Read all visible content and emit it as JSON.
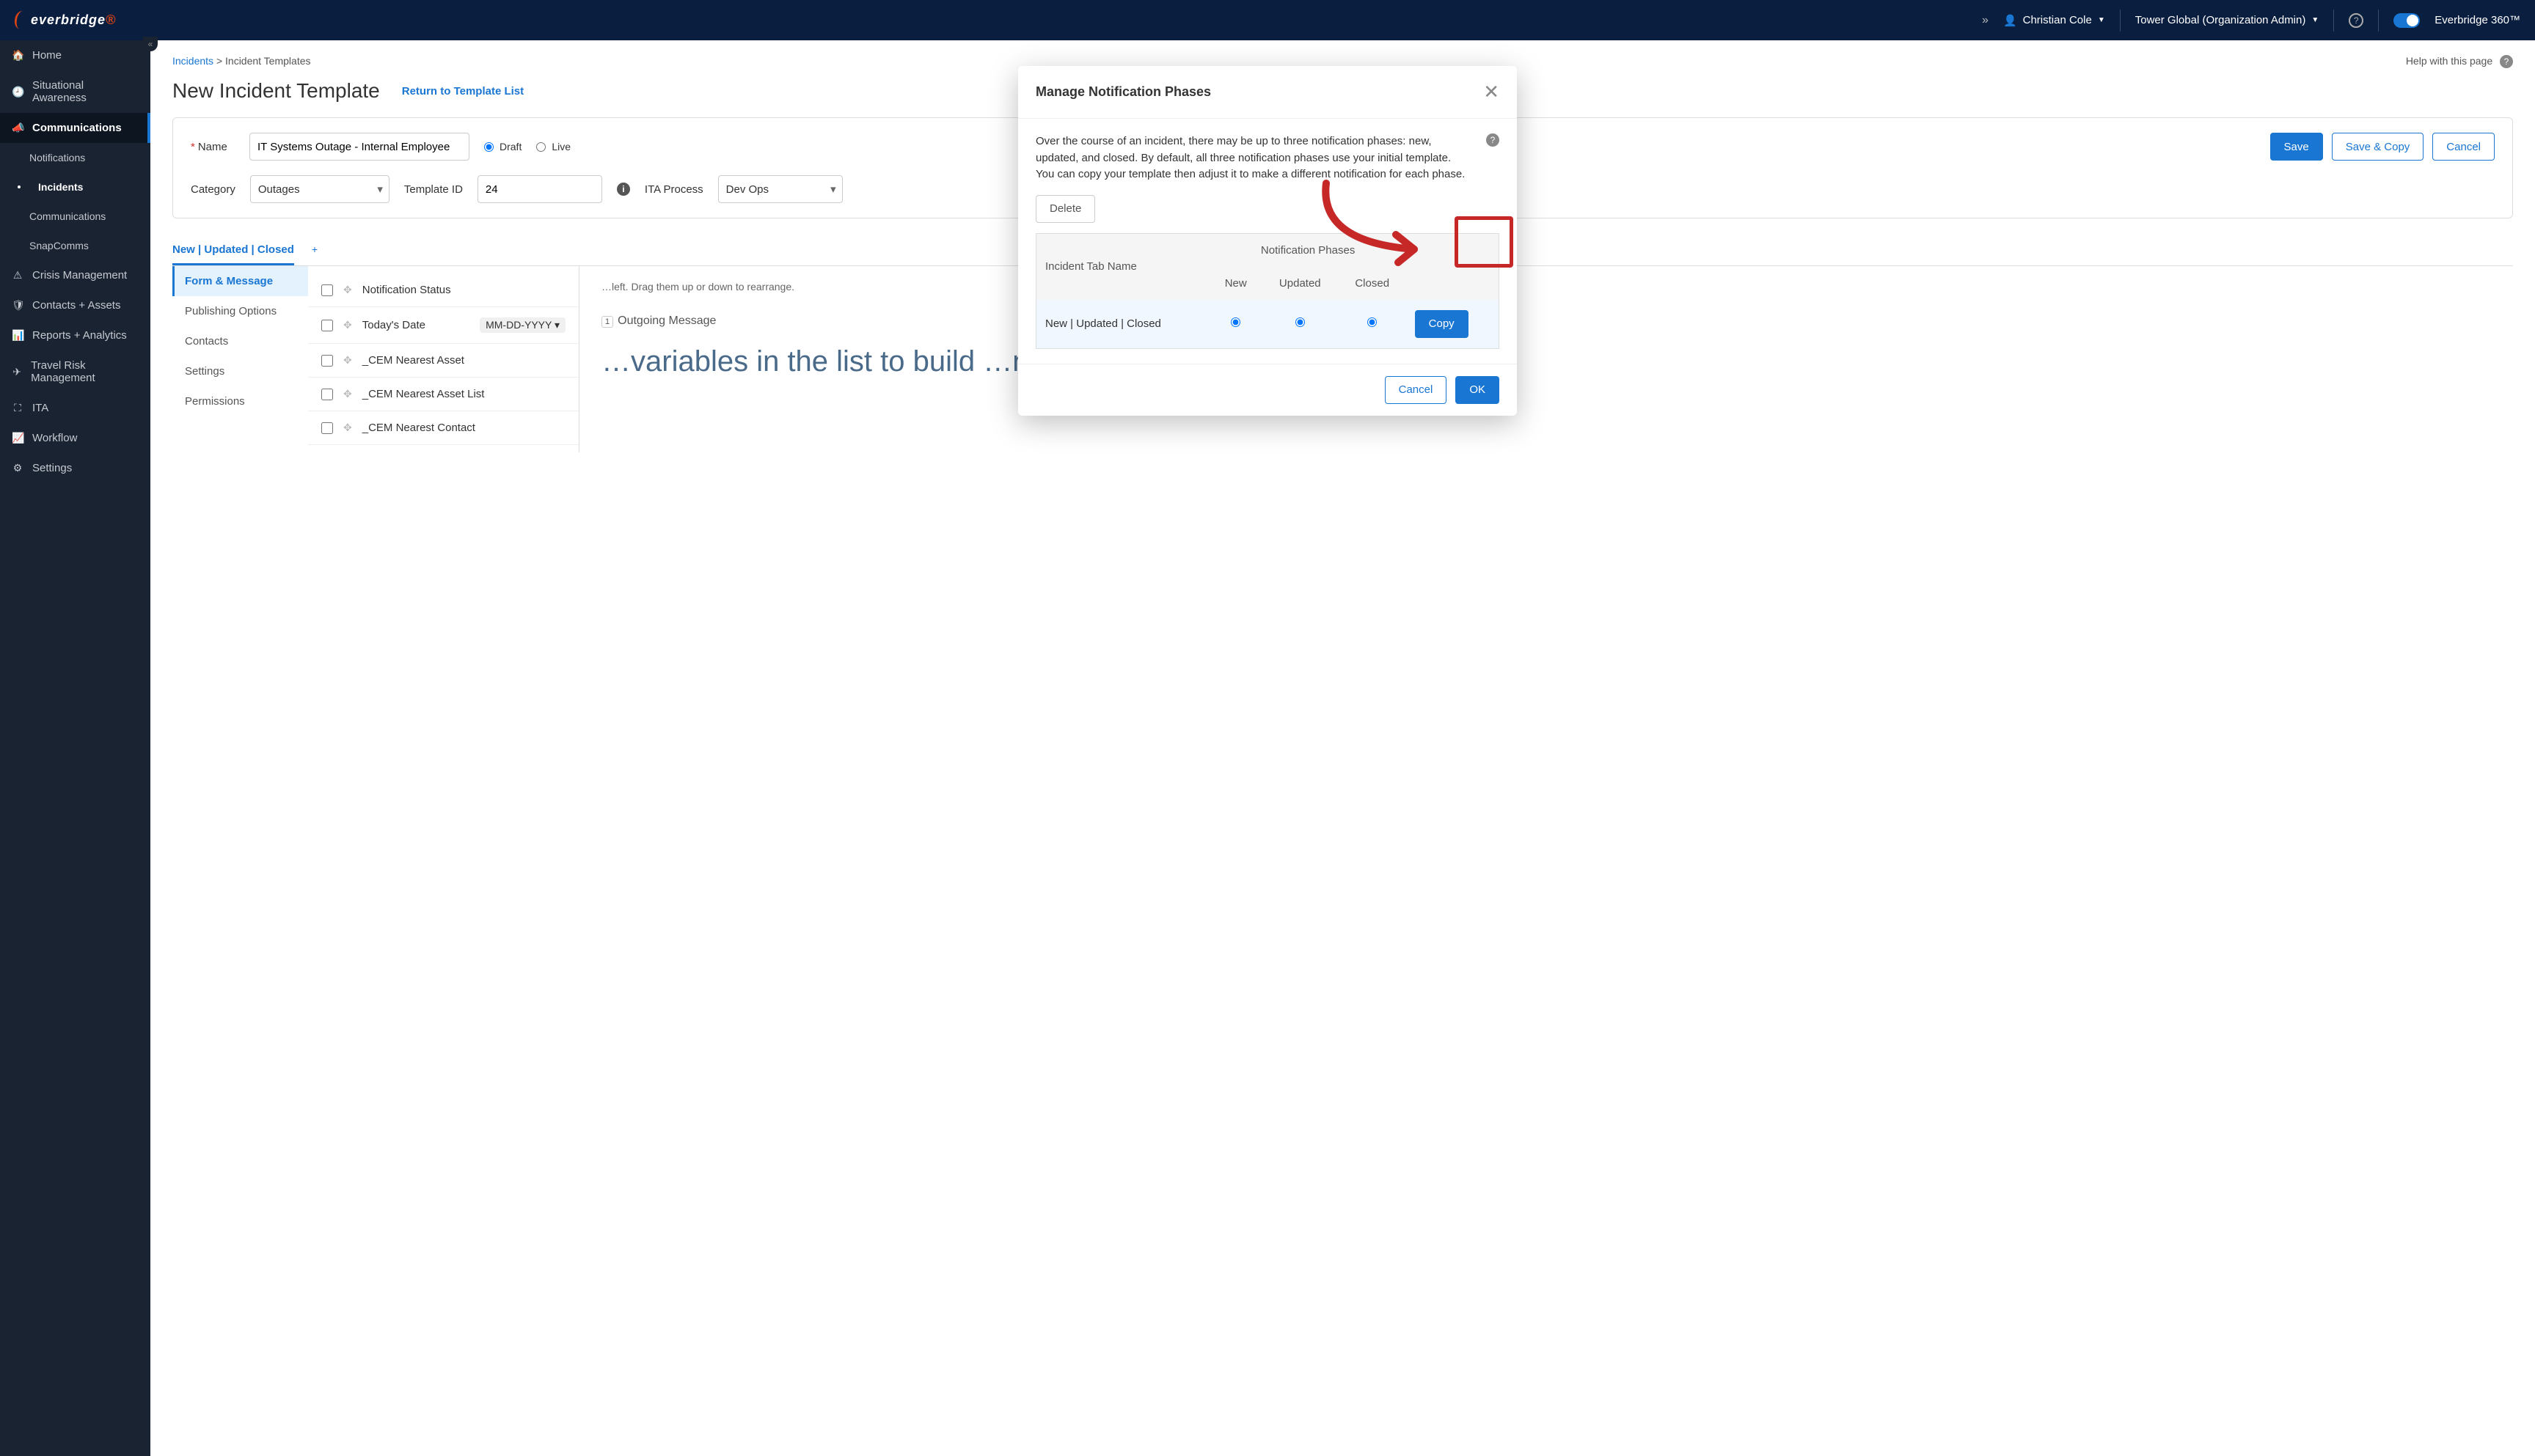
{
  "header": {
    "logo_text": "everbridge",
    "user_name": "Christian Cole",
    "org_label": "Tower Global (Organization Admin)",
    "brand_right": "Everbridge 360™"
  },
  "sidebar": {
    "items": [
      {
        "icon": "home-icon",
        "label": "Home"
      },
      {
        "icon": "clock-icon",
        "label": "Situational Awareness"
      },
      {
        "icon": "megaphone-icon",
        "label": "Communications",
        "active": true
      },
      {
        "sub": true,
        "label": "Notifications"
      },
      {
        "sub": true,
        "label": "Incidents",
        "active_sub": true
      },
      {
        "sub": true,
        "label": "Communications"
      },
      {
        "sub": true,
        "label": "SnapComms"
      },
      {
        "icon": "warning-icon",
        "label": "Crisis Management"
      },
      {
        "icon": "shield-icon",
        "label": "Contacts + Assets"
      },
      {
        "icon": "bar-chart-icon",
        "label": "Reports + Analytics"
      },
      {
        "icon": "plane-icon",
        "label": "Travel Risk Management"
      },
      {
        "icon": "ita-icon",
        "label": "ITA"
      },
      {
        "icon": "workflow-icon",
        "label": "Workflow"
      },
      {
        "icon": "gear-icon",
        "label": "Settings"
      }
    ]
  },
  "breadcrumb": {
    "root": "Incidents",
    "sep": ">",
    "current": "Incident Templates"
  },
  "help_link": "Help with this page",
  "page_title": "New Incident Template",
  "return_link": "Return to Template List",
  "form": {
    "name_label": "Name",
    "name_value": "IT Systems Outage - Internal Employee",
    "status_draft": "Draft",
    "status_live": "Live",
    "category_label": "Category",
    "category_value": "Outages",
    "template_id_label": "Template ID",
    "template_id_value": "24",
    "ita_label": "ITA Process",
    "ita_value": "Dev Ops",
    "save": "Save",
    "save_copy": "Save & Copy",
    "cancel": "Cancel"
  },
  "phase_tab": "New | Updated | Closed",
  "side_tabs": [
    "Form & Message",
    "Publishing Options",
    "Contacts",
    "Settings",
    "Permissions"
  ],
  "hint_text": "…left. Drag them up or down to rearrange.",
  "msg_section_title": "Outgoing Message",
  "msg_big": "…variables in the list to build …n.",
  "variables": [
    {
      "name": "Notification Status"
    },
    {
      "name": "Today's Date",
      "extra": "MM-DD-YYYY"
    },
    {
      "name": "_CEM Nearest Asset"
    },
    {
      "name": "_CEM Nearest Asset List"
    },
    {
      "name": "_CEM Nearest Contact"
    }
  ],
  "modal": {
    "title": "Manage Notification Phases",
    "desc": "Over the course of an incident, there may be up to three notification phases: new, updated, and closed. By default, all three notification phases use your initial template.\nYou can copy your template then adjust it to make a different notification for each phase.",
    "delete": "Delete",
    "col_tab": "Incident Tab Name",
    "col_group": "Notification Phases",
    "col_new": "New",
    "col_updated": "Updated",
    "col_closed": "Closed",
    "row_name": "New | Updated | Closed",
    "copy": "Copy",
    "cancel": "Cancel",
    "ok": "OK"
  }
}
